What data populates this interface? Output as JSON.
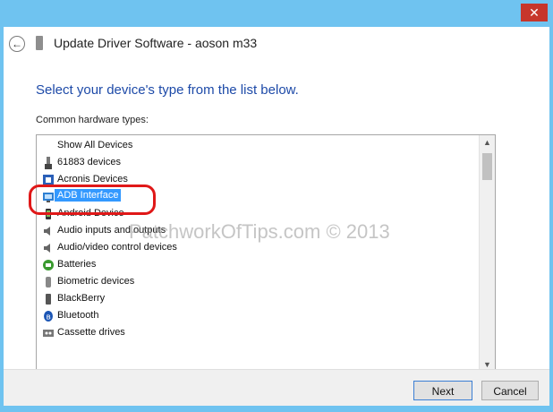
{
  "window": {
    "close_glyph": "✕"
  },
  "dialog": {
    "title": "Update Driver Software - aoson m33",
    "heading": "Select your device's type from the list below.",
    "list_label": "Common hardware types:"
  },
  "list": {
    "items": [
      {
        "label": "Show All Devices",
        "icon": "none"
      },
      {
        "label": "61883 devices",
        "icon": "usb-device-icon"
      },
      {
        "label": "Acronis Devices",
        "icon": "acronis-icon"
      },
      {
        "label": "ADB Interface",
        "icon": "adb-interface-icon",
        "selected": true
      },
      {
        "label": "Android Device",
        "icon": "android-device-icon"
      },
      {
        "label": "Audio inputs and outputs",
        "icon": "speaker-icon"
      },
      {
        "label": "Audio/video control devices",
        "icon": "speaker-icon"
      },
      {
        "label": "Batteries",
        "icon": "battery-icon"
      },
      {
        "label": "Biometric devices",
        "icon": "fingerprint-icon"
      },
      {
        "label": "BlackBerry",
        "icon": "phone-icon"
      },
      {
        "label": "Bluetooth",
        "icon": "bluetooth-icon"
      },
      {
        "label": "Cassette drives",
        "icon": "cassette-icon"
      }
    ]
  },
  "watermark": "PatchworkOfTips.com © 2013",
  "buttons": {
    "next": "Next",
    "cancel": "Cancel"
  },
  "colors": {
    "accent": "#1d4aa8",
    "selection": "#3399ff",
    "highlight_ring": "#e01818"
  }
}
